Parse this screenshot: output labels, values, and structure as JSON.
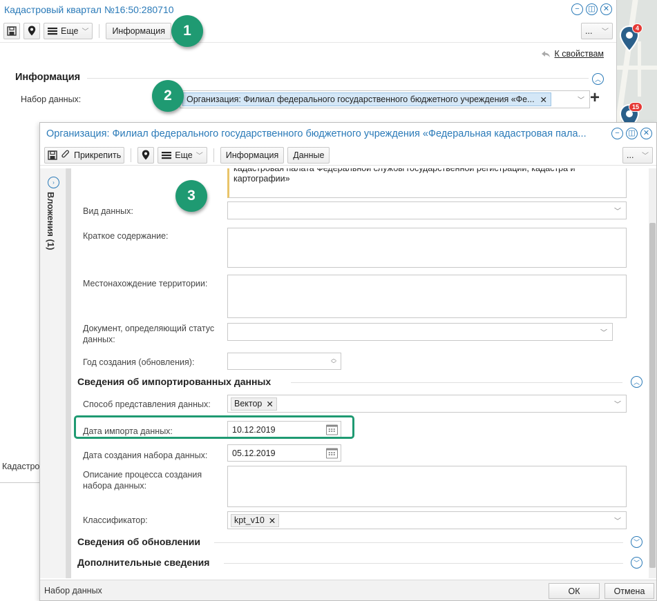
{
  "window_main": {
    "title": "Кадастровый квартал №16:50:280710",
    "toolbar": {
      "more_label": "Еще",
      "info_label": "Информация",
      "overflow_label": "..."
    },
    "back_link": "К свойствам",
    "section_title": "Информация",
    "dataset_label": "Набор данных:",
    "dataset_value": "Организация: Филиал федерального государственного бюджетного учреждения «Фе...",
    "bottom_clipped_text": "Кадастров"
  },
  "map": {
    "pin1_count": "4",
    "pin2_count": "15"
  },
  "dialog": {
    "title": "Организация: Филиал федерального государственного бюджетного учреждения «Федеральная кадастровая пала...",
    "toolbar": {
      "attach_label": "Прикрепить",
      "more_label": "Еще",
      "info_label": "Информация",
      "data_label": "Данные",
      "overflow_label": "..."
    },
    "side_tab": "Вложения (1)",
    "org_text": "кадастровая палата Федеральной службы государственной регистрации, кадастра и картографии»",
    "fields": {
      "data_type_label": "Вид данных:",
      "summary_label": "Краткое содержание:",
      "location_label": "Местонахождение территории:",
      "status_doc_label": "Документ, определяющий статус данных:",
      "year_label": "Год создания (обновления):"
    },
    "imported": {
      "title": "Сведения об импортированных данных",
      "method_label": "Способ представления данных:",
      "method_value": "Вектор",
      "import_date_label": "Дата импорта данных:",
      "import_date_value": "10.12.2019",
      "creation_date_label": "Дата создания набора данных:",
      "creation_date_value": "05.12.2019",
      "process_label": "Описание процесса создания набора данных:",
      "classifier_label": "Классификатор:",
      "classifier_value": "kpt_v10"
    },
    "update_title": "Сведения об обновлении",
    "extra_title": "Дополнительные сведения",
    "status_text": "Набор данных",
    "ok_label": "ОК",
    "cancel_label": "Отмена"
  },
  "annotations": {
    "m1": "1",
    "m2": "2",
    "m3": "3"
  },
  "colors": {
    "accent": "#2a7ab8",
    "marker": "#1f9a72",
    "tag": "#d4e7f7"
  }
}
